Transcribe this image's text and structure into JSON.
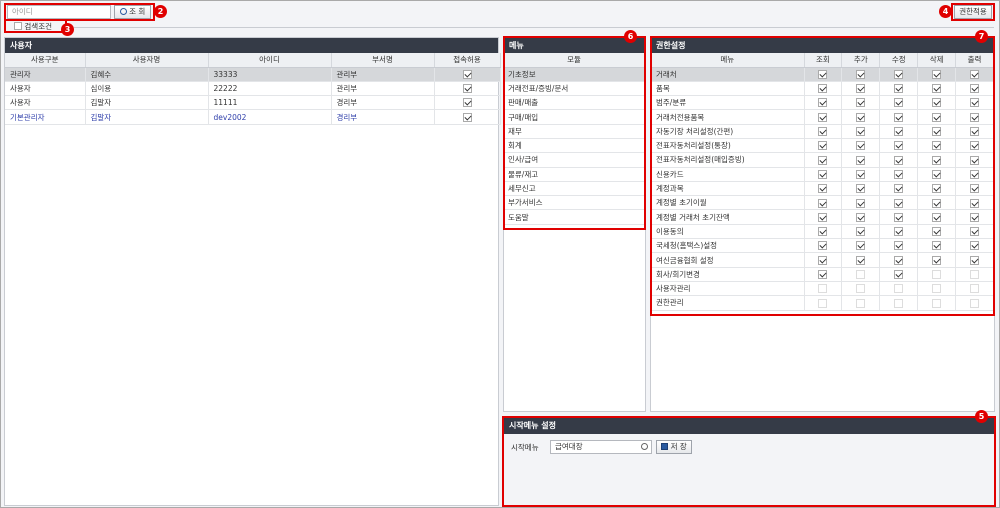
{
  "topbar": {
    "search_placeholder": "아이디",
    "search_button": "조 회",
    "condition_checkbox_label": "검색조건",
    "permission_apply_button": "권한적용"
  },
  "badges": [
    "2",
    "3",
    "4",
    "5",
    "6",
    "7"
  ],
  "users_panel": {
    "title": "사용자",
    "columns": [
      "사용구분",
      "사용자명",
      "아이디",
      "부서명",
      "접속허용"
    ],
    "rows": [
      {
        "type": "관리자",
        "name": "김혜수",
        "id": "33333",
        "dept": "관리부",
        "allowed": true
      },
      {
        "type": "사용자",
        "name": "심이용",
        "id": "22222",
        "dept": "관리부",
        "allowed": true
      },
      {
        "type": "사용자",
        "name": "김말자",
        "id": "11111",
        "dept": "경리부",
        "allowed": true
      },
      {
        "type": "기본관리자",
        "name": "김말자",
        "id": "dev2002",
        "dept": "경리부",
        "allowed": true
      }
    ]
  },
  "menu_panel": {
    "title": "메뉴",
    "column": "모듈",
    "items": [
      "기초정보",
      "거래전표/증빙/문서",
      "판매/매출",
      "구매/매입",
      "재무",
      "회계",
      "인사/급여",
      "물류/재고",
      "세무신고",
      "부가서비스",
      "도움말"
    ]
  },
  "permission_panel": {
    "title": "권한설정",
    "columns": [
      "메뉴",
      "조회",
      "추가",
      "수정",
      "삭제",
      "출력"
    ],
    "rows": [
      {
        "menu": "거래처",
        "checks": [
          true,
          true,
          true,
          true,
          true
        ]
      },
      {
        "menu": "품목",
        "checks": [
          true,
          true,
          true,
          true,
          true
        ]
      },
      {
        "menu": "범주/분류",
        "checks": [
          true,
          true,
          true,
          true,
          true
        ]
      },
      {
        "menu": "거래처전용품목",
        "checks": [
          true,
          true,
          true,
          true,
          true
        ]
      },
      {
        "menu": "자동기장 처리설정(간편)",
        "checks": [
          true,
          true,
          true,
          true,
          true
        ]
      },
      {
        "menu": "전표자동처리설정(통장)",
        "checks": [
          true,
          true,
          true,
          true,
          true
        ]
      },
      {
        "menu": "전표자동처리설정(매입증빙)",
        "checks": [
          true,
          true,
          true,
          true,
          true
        ]
      },
      {
        "menu": "신용카드",
        "checks": [
          true,
          true,
          true,
          true,
          true
        ]
      },
      {
        "menu": "계정과목",
        "checks": [
          true,
          true,
          true,
          true,
          true
        ]
      },
      {
        "menu": "계정별 초기이월",
        "checks": [
          true,
          true,
          true,
          true,
          true
        ]
      },
      {
        "menu": "계정별 거래처 초기잔액",
        "checks": [
          true,
          true,
          true,
          true,
          true
        ]
      },
      {
        "menu": "이용동의",
        "checks": [
          true,
          true,
          true,
          true,
          true
        ]
      },
      {
        "menu": "국세청(홈택스)설정",
        "checks": [
          true,
          true,
          true,
          true,
          true
        ]
      },
      {
        "menu": "여신금융협회 설정",
        "checks": [
          true,
          true,
          true,
          true,
          true
        ]
      },
      {
        "menu": "회사/회기변경",
        "checks": [
          true,
          false,
          true,
          false,
          false
        ]
      },
      {
        "menu": "사용자관리",
        "checks": [
          false,
          false,
          false,
          false,
          false
        ]
      },
      {
        "menu": "권한관리",
        "checks": [
          false,
          false,
          false,
          false,
          false
        ]
      }
    ]
  },
  "start_menu_panel": {
    "title": "시작메뉴 설정",
    "label": "시작메뉴",
    "value": "급여대장",
    "save_button": "저 장"
  }
}
